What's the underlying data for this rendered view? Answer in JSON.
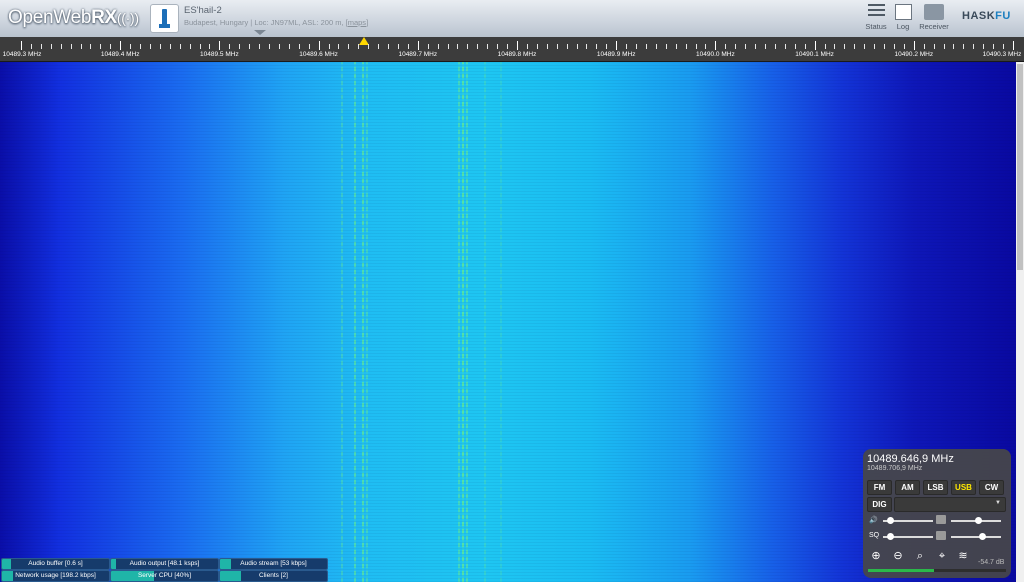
{
  "header": {
    "logo_prefix": "OpenWeb",
    "logo_suffix": "RX",
    "logo_waves": "((·))",
    "receiver_name": "ES'hail-2",
    "receiver_desc": "Budapest, Hungary | Loc: JN97ML, ASL: 200 m, [",
    "maps_link": "maps",
    "receiver_desc_end": "]",
    "buttons": [
      {
        "label": "Status"
      },
      {
        "label": "Log"
      },
      {
        "label": "Receiver"
      }
    ],
    "brand_prefix": "HASK",
    "brand_suffix": "FU"
  },
  "scale": {
    "labels": [
      "10489.3 MHz",
      "10489.4 MHz",
      "10489.5 MHz",
      "10489.6 MHz",
      "10489.7 MHz",
      "10489.8 MHz",
      "10489.9 MHz",
      "10490.0 MHz",
      "10490.1 MHz",
      "10490.2 MHz",
      "10490.3 MHz"
    ]
  },
  "status_bars": [
    {
      "label": "Audio buffer [0.6 s]",
      "level": 0.08
    },
    {
      "label": "Audio output [48.1 ksps]",
      "level": 0.05
    },
    {
      "label": "Audio stream [53 kbps]",
      "level": 0.1
    },
    {
      "label": "Network usage [198.2 kbps]",
      "level": 0.1
    },
    {
      "label": "Server CPU [40%]",
      "level": 0.4
    },
    {
      "label": "Clients [2]",
      "level": 0.2
    }
  ],
  "panel": {
    "freq_main": "10489.646,9 MHz",
    "freq_sub": "10489.706,9 MHz",
    "modes": [
      "FM",
      "AM",
      "LSB",
      "USB",
      "CW"
    ],
    "active_mode": "USB",
    "dig": "DIG",
    "dig_arrow": "▼",
    "volume_icon": "🔊",
    "squelch_label": "SQ",
    "smeter_value": "-54.7 dB",
    "smeter_level": 0.48,
    "volume_level": 0.1,
    "sq_level": 0.1,
    "rf_level": 0.55,
    "gain_level": 0.65
  },
  "colors": {
    "active_mode": "#ffe900",
    "smeter": "#2bb84a",
    "waterfall_signal": "#5ae6a0"
  },
  "icons": {
    "status": "status-icon",
    "log": "log-icon",
    "receiver": "receiver-icon",
    "zoom_in": "zoom-in-icon",
    "zoom_out": "zoom-out-icon",
    "zoom_band": "zoom-band-icon",
    "zoom_reset": "zoom-reset-icon",
    "waterfall_auto": "waterfall-auto-icon"
  }
}
